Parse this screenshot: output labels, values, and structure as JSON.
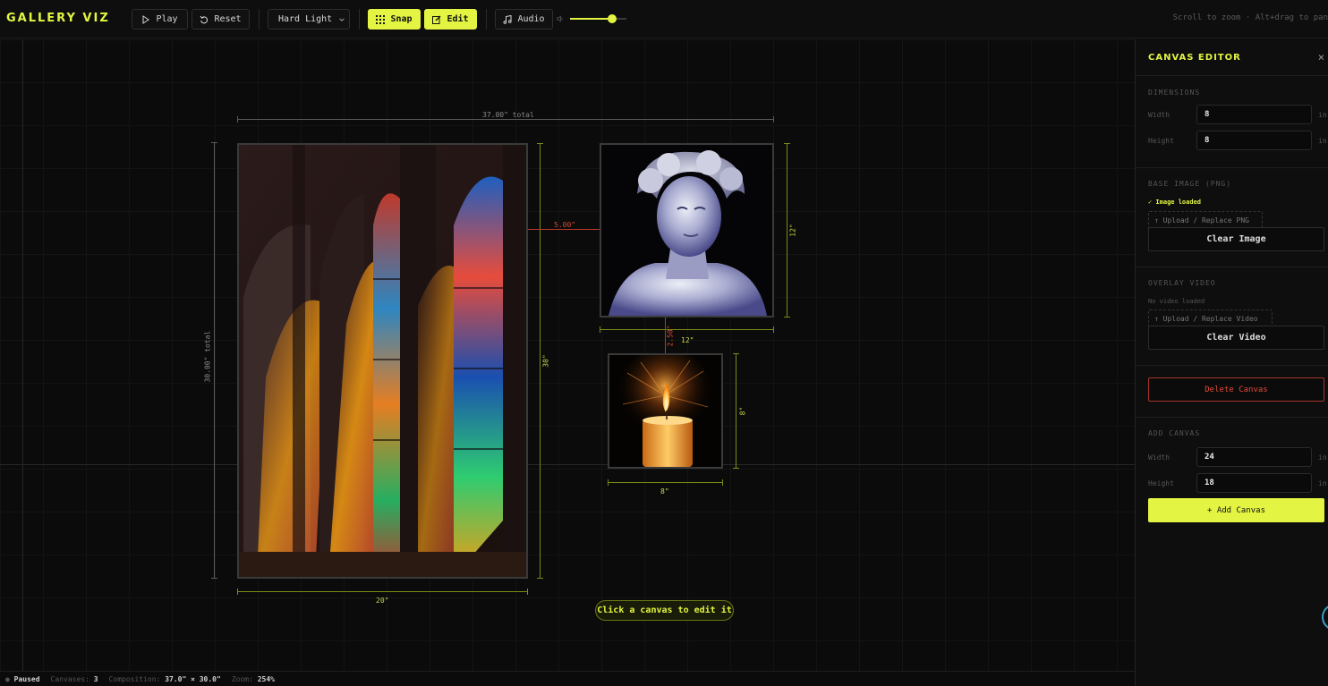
{
  "app": {
    "title": "GALLERY VIZ"
  },
  "toolbar": {
    "play_label": "Play",
    "reset_label": "Reset",
    "blend_mode": "Hard Light",
    "snap_label": "Snap",
    "edit_label": "Edit",
    "audio_label": "Audio",
    "volume": 0.75,
    "hint": "Scroll to zoom · Alt+drag to pan"
  },
  "canvas_area": {
    "total_width_label": "37.00\" total",
    "total_height_label": "30.00\" total",
    "gap_h_label": "5.00\"",
    "gap_v_label": "2.50\"",
    "canvases": [
      {
        "name": "Stained glass window",
        "width_label": "20\"",
        "height_label": "30\""
      },
      {
        "name": "Marble bust",
        "width_label": "12\"",
        "height_label": "12\""
      },
      {
        "name": "Candle",
        "width_label": "8\"",
        "height_label": "8\""
      }
    ],
    "toast": "Click a canvas to edit it"
  },
  "status": {
    "state": "Paused",
    "canvases_label": "Canvases:",
    "canvases_value": "3",
    "composition_label": "Composition:",
    "composition_value": "37.0\" × 30.0\"",
    "zoom_label": "Zoom:",
    "zoom_value": "254%"
  },
  "panel": {
    "title": "CANVAS EDITOR",
    "close_icon": "×",
    "dimensions": {
      "header": "DIMENSIONS",
      "width_label": "Width",
      "width_value": "8",
      "height_label": "Height",
      "height_value": "8",
      "unit": "in"
    },
    "base_image": {
      "header": "BASE IMAGE (PNG)",
      "status": "✓ Image loaded",
      "upload_label": "↑ Upload / Replace PNG",
      "clear_label": "Clear Image"
    },
    "overlay_video": {
      "header": "OVERLAY VIDEO",
      "status": "No video loaded",
      "upload_label": "↑ Upload / Replace Video",
      "clear_label": "Clear Video"
    },
    "delete_label": "Delete Canvas",
    "add_canvas": {
      "header": "ADD CANVAS",
      "width_label": "Width",
      "width_value": "24",
      "height_label": "Height",
      "height_value": "18",
      "unit": "in",
      "button_label": "+ Add Canvas"
    }
  },
  "colors": {
    "accent": "#e3f542",
    "danger": "#e04a3a",
    "background": "#0b0b0b"
  }
}
